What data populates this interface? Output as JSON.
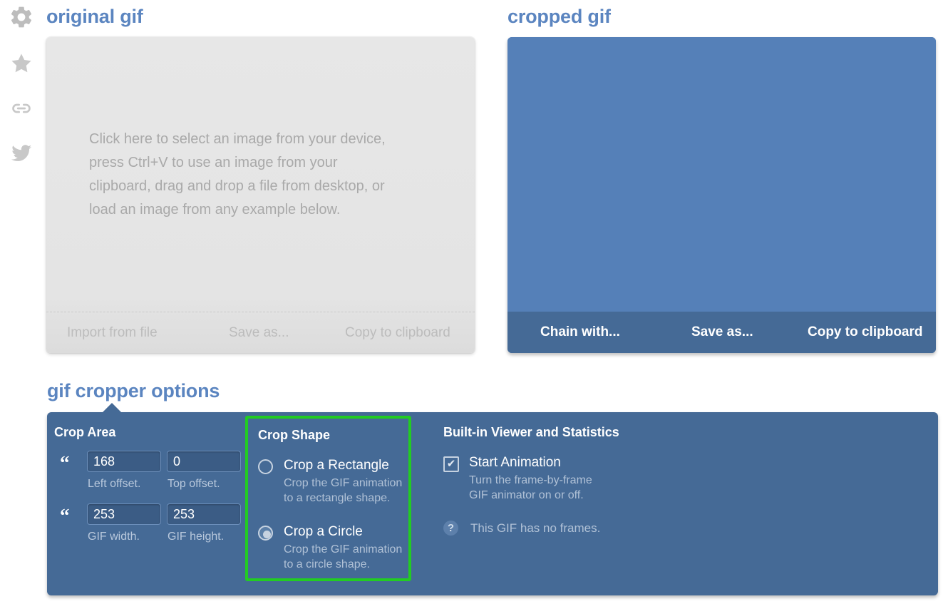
{
  "sidebar": {
    "items": [
      {
        "icon": "gear-icon",
        "name": "settings"
      },
      {
        "icon": "star-icon",
        "name": "favorite"
      },
      {
        "icon": "link-icon",
        "name": "permalink"
      },
      {
        "icon": "twitter-icon",
        "name": "share-twitter"
      }
    ]
  },
  "original": {
    "title": "original gif",
    "hint_lines": [
      "Click here to select an image from your device,",
      "press Ctrl+V to use an image from your",
      "clipboard, drag and drop a file from desktop, or",
      "load an image from any example below."
    ],
    "toolbar": {
      "import": "Import from file",
      "save_as": "Save as...",
      "copy": "Copy to clipboard"
    }
  },
  "cropped": {
    "title": "cropped gif",
    "canvas_color": "#5580b8",
    "toolbar": {
      "chain": "Chain with...",
      "save_as": "Save as...",
      "copy": "Copy to clipboard"
    }
  },
  "options": {
    "title": "gif cropper options",
    "panel_color": "#456a96",
    "highlight_color": "#22cc22",
    "crop_area": {
      "heading": "Crop Area",
      "fields": [
        {
          "value": "168",
          "label": "Left offset."
        },
        {
          "value": "0",
          "label": "Top offset."
        },
        {
          "value": "253",
          "label": "GIF width."
        },
        {
          "value": "253",
          "label": "GIF height."
        }
      ]
    },
    "crop_shape": {
      "heading": "Crop Shape",
      "options": [
        {
          "label": "Crop a Rectangle",
          "desc_line1": "Crop the GIF animation",
          "desc_line2": "to a rectangle shape.",
          "selected": false
        },
        {
          "label": "Crop a Circle",
          "desc_line1": "Crop the GIF animation",
          "desc_line2": "to a circle shape.",
          "selected": true
        }
      ]
    },
    "viewer": {
      "heading": "Built-in Viewer and Statistics",
      "checkbox": {
        "label": "Start Animation",
        "desc_line1": "Turn the frame-by-frame",
        "desc_line2": "GIF animator on or off.",
        "checked": true,
        "glyph": "✔"
      },
      "note": {
        "icon_glyph": "?",
        "text": "This GIF has no frames."
      }
    }
  }
}
